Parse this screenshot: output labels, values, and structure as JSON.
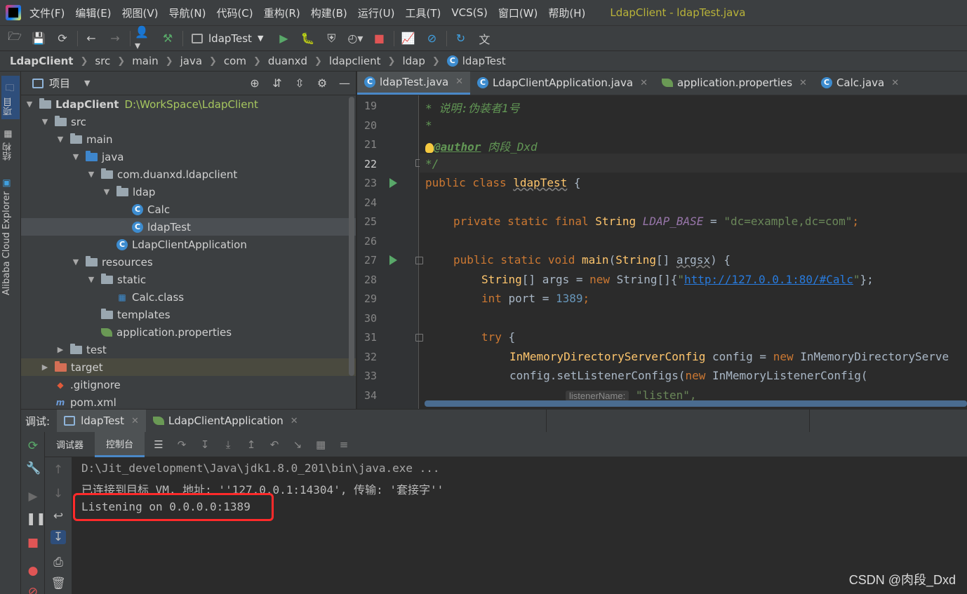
{
  "menubar": {
    "items": [
      "文件(F)",
      "编辑(E)",
      "视图(V)",
      "导航(N)",
      "代码(C)",
      "重构(R)",
      "构建(B)",
      "运行(U)",
      "工具(T)",
      "VCS(S)",
      "窗口(W)",
      "帮助(H)"
    ],
    "window_title": "LdapClient - ldapTest.java"
  },
  "toolbar": {
    "run_config": "ldapTest"
  },
  "breadcrumb": [
    "LdapClient",
    "src",
    "main",
    "java",
    "com",
    "duanxd",
    "ldapclient",
    "ldap",
    "ldapTest"
  ],
  "left_stripe": {
    "project_label": "项目",
    "structure_label": "结构",
    "cloud_label": "Alibaba Cloud Explorer"
  },
  "project_panel": {
    "title": "项目",
    "root_name": "LdapClient",
    "root_path": "D:\\WorkSpace\\LdapClient",
    "nodes": [
      {
        "label": "src"
      },
      {
        "label": "main"
      },
      {
        "label": "java"
      },
      {
        "label": "com.duanxd.ldapclient"
      },
      {
        "label": "ldap"
      },
      {
        "label": "Calc"
      },
      {
        "label": "ldapTest"
      },
      {
        "label": "LdapClientApplication"
      },
      {
        "label": "resources"
      },
      {
        "label": "static"
      },
      {
        "label": "Calc.class"
      },
      {
        "label": "templates"
      },
      {
        "label": "application.properties"
      },
      {
        "label": "test"
      },
      {
        "label": "target"
      },
      {
        "label": ".gitignore"
      },
      {
        "label": "pom.xml"
      }
    ]
  },
  "editor": {
    "tabs": [
      {
        "label": "ldapTest.java"
      },
      {
        "label": "LdapClientApplication.java"
      },
      {
        "label": "application.properties"
      },
      {
        "label": "Calc.java"
      }
    ],
    "line_numbers": [
      "19",
      "20",
      "21",
      "22",
      "23",
      "24",
      "25",
      "26",
      "27",
      "28",
      "29",
      "30",
      "31",
      "32",
      "33",
      "34"
    ],
    "code": {
      "l19": "* 说明:伪装者1号",
      "l20": "*",
      "l21_tag": "@author",
      "l21_text": " 肉段_Dxd",
      "l22": "*/",
      "l23_kw": "public class ",
      "l23_cls": "ldapTest",
      "l23_rest": " {",
      "l25_kw": "private static final ",
      "l25_type": "String",
      "l25_const": " LDAP_BASE",
      "l25_eq": " = ",
      "l25_str": "\"dc=example,dc=com\"",
      "l25_end": ";",
      "l27_kw": "public static void ",
      "l27_fn": "main",
      "l27_open": "(",
      "l27_type": "String",
      "l27_arr": "[] ",
      "l27_param": "argsx",
      "l27_end": ") {",
      "l28_type": "String",
      "l28_mid": "[] args = ",
      "l28_kw": "new ",
      "l28_new": "String[]{",
      "l28_str_q1": "\"",
      "l28_url": "http://127.0.0.1:80/#Calc",
      "l28_str_q2": "\"",
      "l28_end": "};",
      "l29_kw": "int ",
      "l29_mid": "port = ",
      "l29_num": "1389",
      "l29_end": ";",
      "l31_kw": "try",
      "l31_end": " {",
      "l32_type": "InMemoryDirectoryServerConfig",
      "l32_mid": " config = ",
      "l32_kw": "new ",
      "l32_rest": "InMemoryDirectoryServe",
      "l33_text": "config.setListenerConfigs(",
      "l33_kw": "new ",
      "l33_rest": "InMemoryListenerConfig(",
      "l34_hint": "listenerName:",
      "l34_str": " \"listen\","
    }
  },
  "debug": {
    "label": "调试:",
    "tabs": [
      {
        "label": "ldapTest"
      },
      {
        "label": "LdapClientApplication"
      }
    ],
    "subtabs": [
      "调试器",
      "控制台"
    ],
    "console_lines": [
      "D:\\Jit_development\\Java\\jdk1.8.0_201\\bin\\java.exe ...",
      "已连接到目标 VM, 地址: ''127.0.0.1:14304', 传输: '套接字''",
      "Listening on 0.0.0.0:1389"
    ]
  },
  "watermark": "CSDN @肉段_Dxd"
}
